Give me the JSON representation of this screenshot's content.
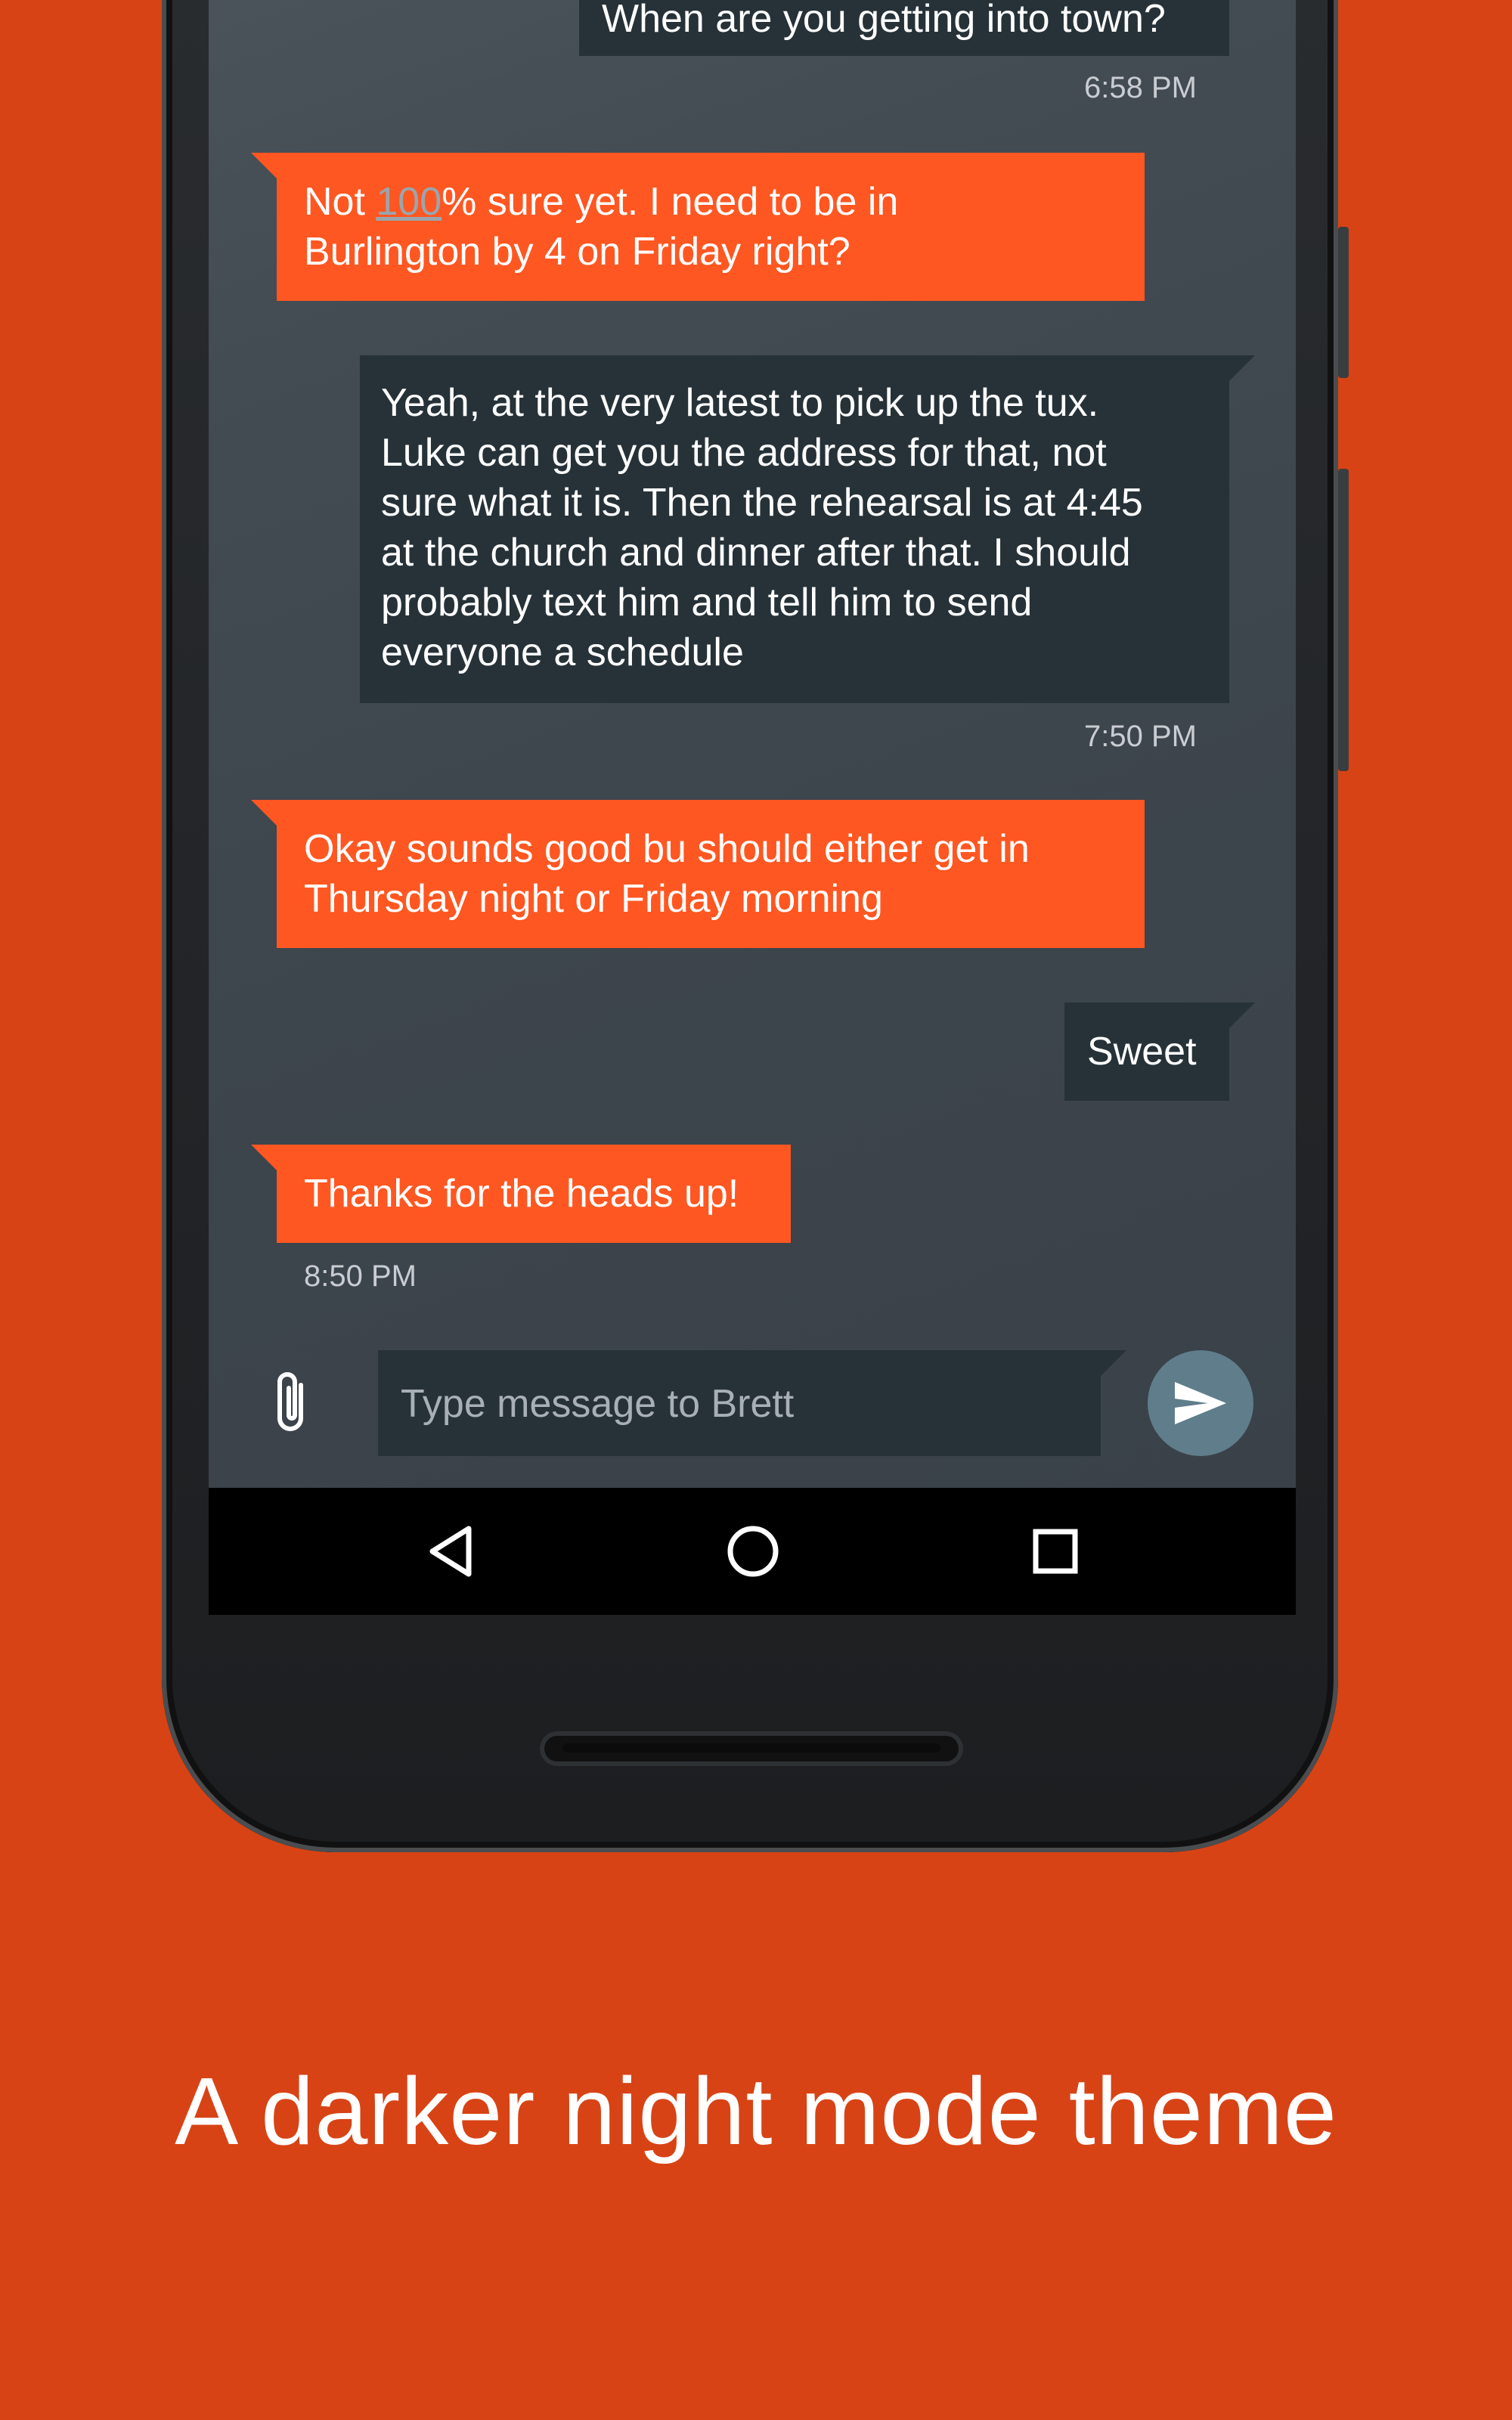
{
  "conversation": {
    "messages": [
      {
        "direction": "out",
        "text": "When are you getting into town?",
        "time": "6:58 PM"
      },
      {
        "direction": "in",
        "text_parts": [
          "Not ",
          "100",
          "% sure yet. I need to be in",
          "Burlington by 4 on Friday right?"
        ]
      },
      {
        "direction": "out",
        "lines": [
          "Yeah, at the very latest to pick up the tux.",
          "Luke can get you the address for that, not",
          "sure what it is. Then the rehearsal is at 4:45",
          "at the church and dinner after that. I should",
          "probably text him and tell him to send",
          "everyone a schedule"
        ],
        "time": "7:50 PM"
      },
      {
        "direction": "in",
        "lines": [
          "Okay sounds good bu should either get in",
          "Thursday night or Friday morning"
        ]
      },
      {
        "direction": "out",
        "text": "Sweet"
      },
      {
        "direction": "in",
        "text": "Thanks for the heads up!",
        "time": "8:50 PM"
      }
    ]
  },
  "composer": {
    "placeholder": "Type message to Brett",
    "attach_icon": "paperclip-icon",
    "send_icon": "send-icon"
  },
  "navbar": {
    "back_icon": "back-triangle-icon",
    "home_icon": "home-circle-icon",
    "recents_icon": "recents-square-icon"
  },
  "caption": "A darker night mode theme",
  "colors": {
    "background": "#d84315",
    "incoming_bubble": "#ff5722",
    "outgoing_bubble": "#263238",
    "send_button": "#607d8b"
  }
}
